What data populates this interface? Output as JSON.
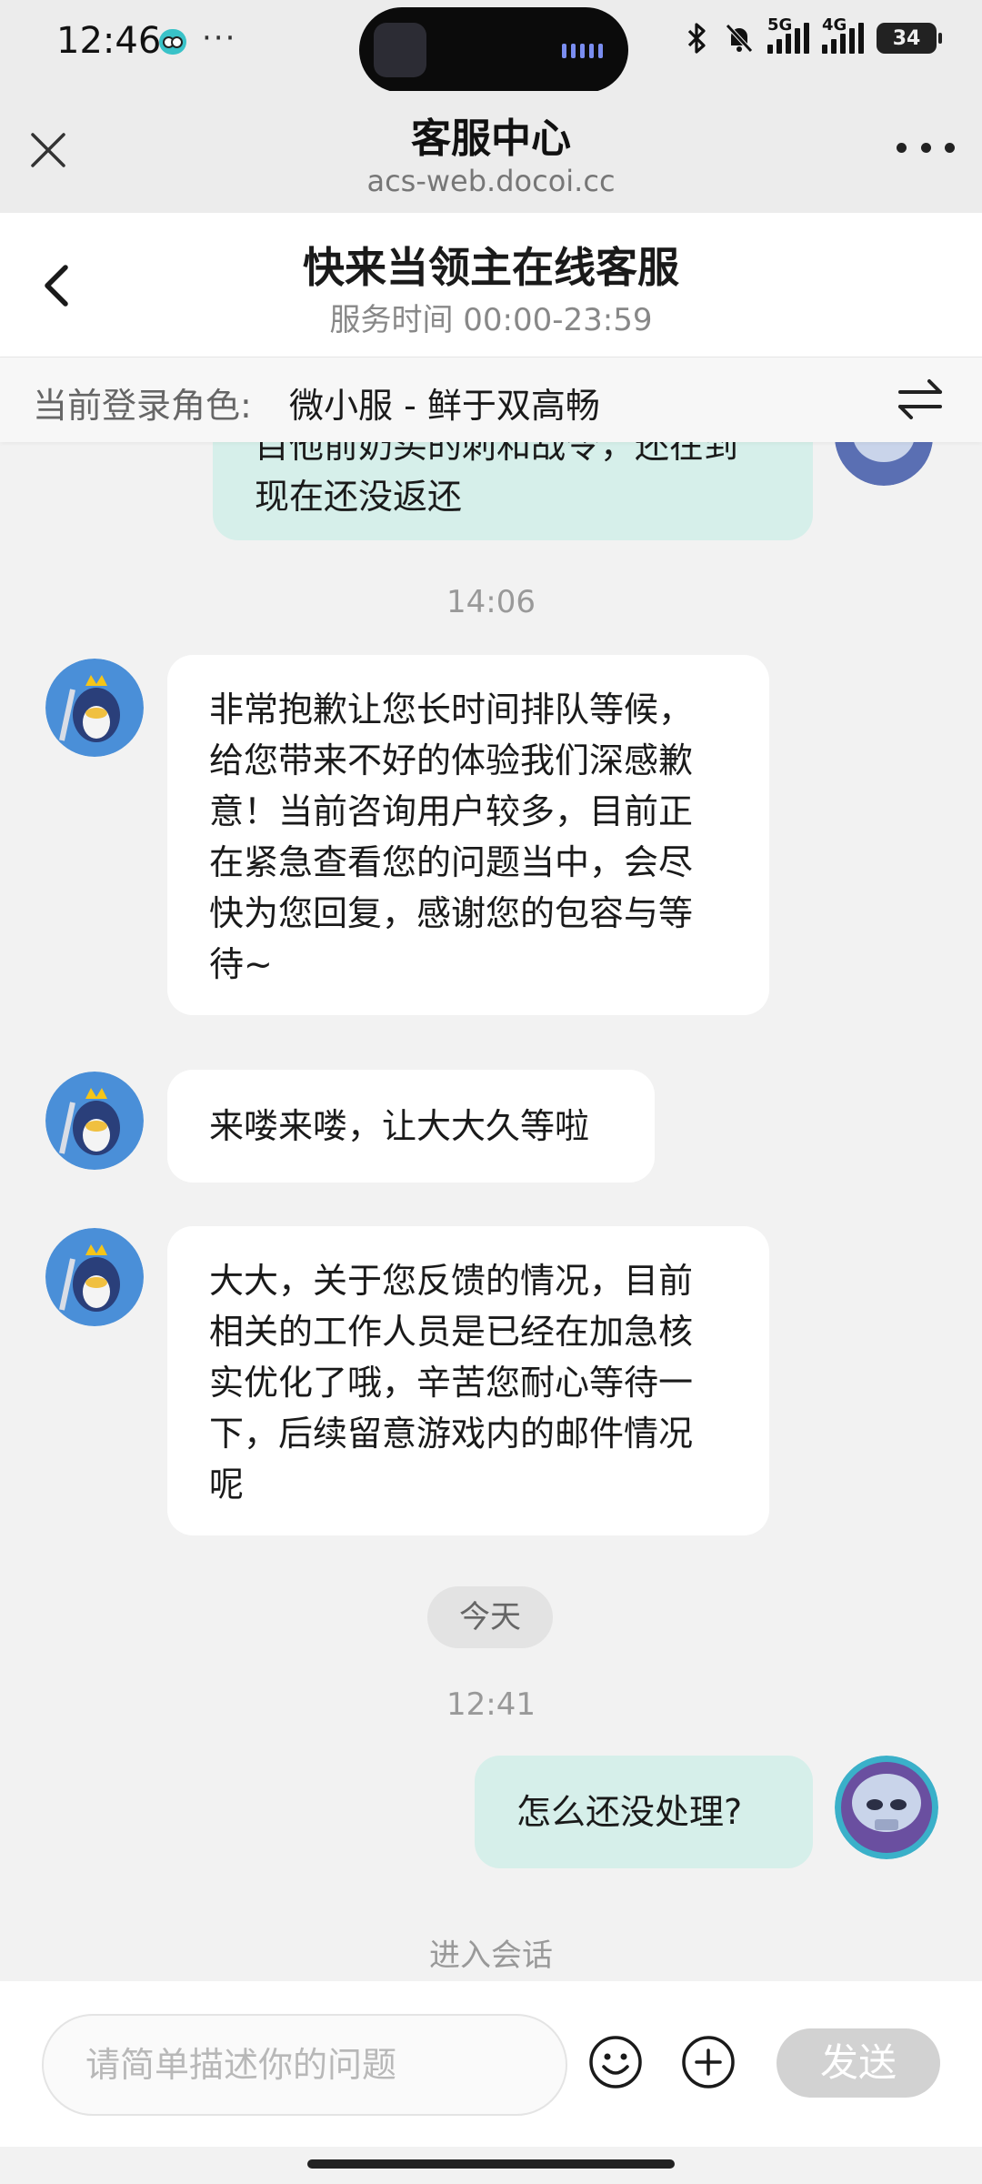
{
  "status_bar": {
    "time": "12:46",
    "dots": "···",
    "net1": "5G",
    "net2": "4G",
    "battery": "34"
  },
  "browser": {
    "title": "客服中心",
    "url": "acs-web.docoi.cc"
  },
  "app_header": {
    "title": "快来当领主在线客服",
    "service_hours": "服务时间 00:00-23:59"
  },
  "role_bar": {
    "label": "当前登录角色:",
    "value": "微小服 - 鲜于双高畅"
  },
  "chat": {
    "partial_user_message_lines": [
      "目他前奶买的刺和战令，还在到",
      "现在还没返还"
    ],
    "time_1": "14:06",
    "agent_messages": [
      {
        "lines": [
          "非常抱歉让您长时间排队等候，",
          "给您带来不好的体验我们深感歉",
          "意！当前咨询用户较多，目前正",
          "在紧急查看您的问题当中，会尽",
          "快为您回复，感谢您的包容与等",
          "待~"
        ]
      },
      {
        "lines": [
          "来喽来喽，让大大久等啦"
        ]
      },
      {
        "lines": [
          "大大，关于您反馈的情况，目前",
          "相关的工作人员是已经在加急核",
          "实优化了哦，辛苦您耐心等待一",
          "下，后续留意游戏内的邮件情况",
          "呢"
        ]
      }
    ],
    "day_divider": "今天",
    "time_2": "12:41",
    "user_message": "怎么还没处理?",
    "system_note": "进入会话"
  },
  "input_bar": {
    "placeholder": "请简单描述你的问题",
    "send_label": "发送"
  },
  "colors": {
    "user_bubble": "#d6efea",
    "agent_bubble": "#ffffff",
    "send_disabled": "#d2d2d2",
    "background": "#f2f2f2"
  },
  "icons": {
    "close": "close-icon",
    "more": "more-icon",
    "back": "chevron-left-icon",
    "switch": "switch-arrows-icon",
    "emoji": "emoji-icon",
    "plus": "plus-circle-icon"
  }
}
